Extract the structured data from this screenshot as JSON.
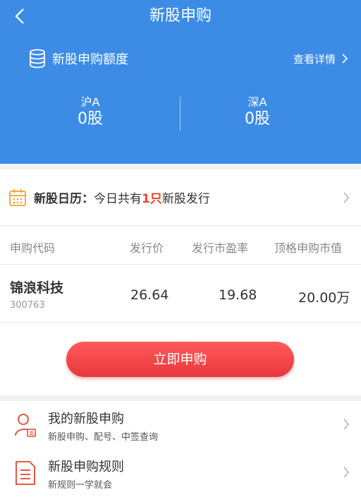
{
  "header": {
    "title": "新股申购",
    "quota_title": "新股申购额度",
    "detail_link": "查看详情",
    "markets": [
      {
        "label": "沪A",
        "value": "0股"
      },
      {
        "label": "深A",
        "value": "0股"
      }
    ]
  },
  "calendar": {
    "label": "新股日历：",
    "text_before": "今日共有",
    "count": "1只",
    "text_after": "新股发行"
  },
  "table": {
    "headers": [
      "申购代码",
      "发行价",
      "发行市盈率",
      "顶格申购市值"
    ],
    "rows": [
      {
        "name": "锦浪科技",
        "code": "300763",
        "price": "26.64",
        "pe": "19.68",
        "max_value": "20.00万"
      }
    ]
  },
  "subscribe_button": "立即申购",
  "menu": [
    {
      "title": "我的新股申购",
      "subtitle": "新股申购、配号、中签查询",
      "icon": "user-doc-icon"
    },
    {
      "title": "新股申购规则",
      "subtitle": "新规则一学就会",
      "icon": "document-icon"
    }
  ],
  "colors": {
    "header_bg": "#3c8ce6",
    "accent_red": "#e8442f",
    "button": "#ee4447",
    "icon_orange": "#f0a030"
  }
}
